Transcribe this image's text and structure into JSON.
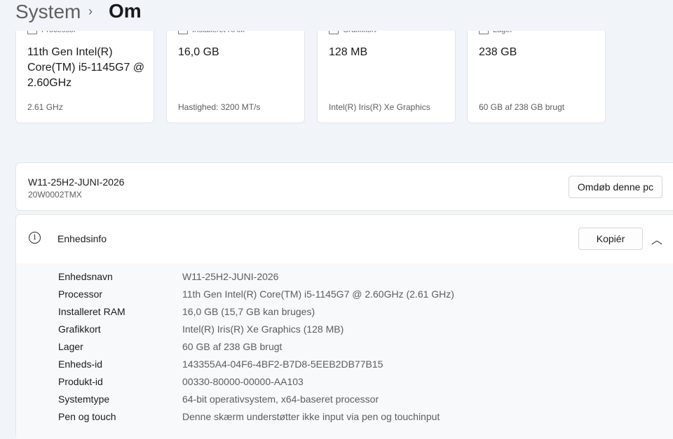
{
  "breadcrumb": {
    "root": "System",
    "separator": "›",
    "current": "Om"
  },
  "spec_cards": [
    {
      "label": "Processor",
      "value": "11th Gen Intel(R) Core(TM) i5-1145G7 @ 2.60GHz",
      "detail": "2.61 GHz",
      "icon": "cpu-icon"
    },
    {
      "label": "Installeret RAM",
      "value": "16,0 GB",
      "detail": "Hastighed: 3200 MT/s",
      "icon": "ram-icon"
    },
    {
      "label": "Grafikkort",
      "value": "128 MB",
      "detail": "Intel(R) Iris(R) Xe Graphics",
      "icon": "gpu-icon"
    },
    {
      "label": "Lager",
      "value": "238 GB",
      "detail": "60 GB af 238 GB brugt",
      "icon": "storage-icon"
    }
  ],
  "device": {
    "name": "W11-25H2-JUNI-2026",
    "model": "20W0002TMX",
    "rename_label": "Omdøb denne pc"
  },
  "device_info": {
    "title": "Enhedsinfo",
    "info_icon": "i",
    "copy_label": "Kopiér",
    "collapse_icon": "chevron-up-icon",
    "rows": [
      {
        "key": "Enhedsnavn",
        "value": "W11-25H2-JUNI-2026"
      },
      {
        "key": "Processor",
        "value": "11th Gen Intel(R) Core(TM) i5-1145G7 @ 2.60GHz (2.61 GHz)"
      },
      {
        "key": "Installeret RAM",
        "value": "16,0 GB (15,7 GB kan bruges)"
      },
      {
        "key": "Grafikkort",
        "value": "Intel(R) Iris(R) Xe Graphics (128 MB)"
      },
      {
        "key": "Lager",
        "value": "60 GB af 238 GB brugt"
      },
      {
        "key": "Enheds-id",
        "value": "143355A4-04F6-4BF2-B7D8-5EEB2DB77B15"
      },
      {
        "key": "Produkt-id",
        "value": "00330-80000-00000-AA103"
      },
      {
        "key": "Systemtype",
        "value": "64-bit operativsystem, x64-baseret processor"
      },
      {
        "key": "Pen og touch",
        "value": "Denne skærm understøtter ikke input via pen og touchinput"
      }
    ]
  }
}
